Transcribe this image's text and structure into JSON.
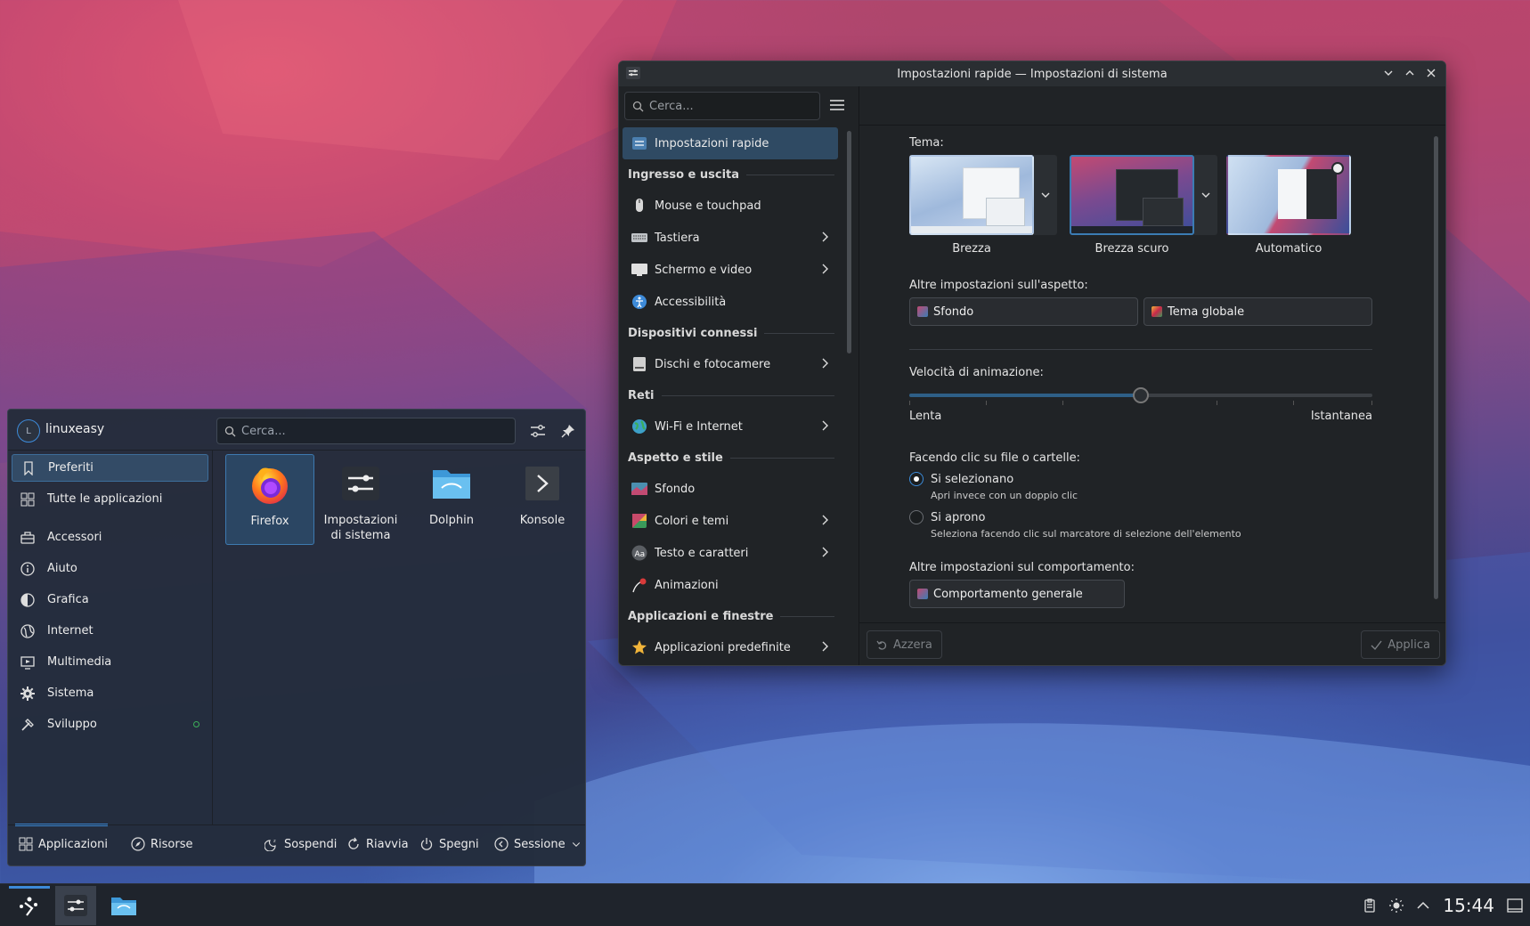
{
  "window": {
    "title": "Impostazioni rapide — Impostazioni di sistema",
    "search_placeholder": "Cerca...",
    "page_title": "Impostazioni rapide"
  },
  "sidebar": {
    "items": [
      {
        "type": "item",
        "label": "Impostazioni rapide",
        "icon": "quick-settings-icon",
        "active": true,
        "chevron": false,
        "color": "#4b7fb0"
      },
      {
        "type": "header",
        "label": "Ingresso e uscita"
      },
      {
        "type": "item",
        "label": "Mouse e touchpad",
        "icon": "mouse-icon",
        "chevron": false,
        "color": "#d8d8d8"
      },
      {
        "type": "item",
        "label": "Tastiera",
        "icon": "keyboard-icon",
        "chevron": true,
        "color": "#bfc3c7"
      },
      {
        "type": "item",
        "label": "Schermo e video",
        "icon": "display-icon",
        "chevron": true,
        "color": "#e0e0e0"
      },
      {
        "type": "item",
        "label": "Accessibilità",
        "icon": "accessibility-icon",
        "chevron": false,
        "color": "#3d8ad8"
      },
      {
        "type": "header",
        "label": "Dispositivi connessi"
      },
      {
        "type": "item",
        "label": "Dischi e fotocamere",
        "icon": "disk-icon",
        "chevron": true,
        "color": "#d0d0d0"
      },
      {
        "type": "header",
        "label": "Reti"
      },
      {
        "type": "item",
        "label": "Wi-Fi e Internet",
        "icon": "globe-icon",
        "chevron": true,
        "color": "#3da0c8"
      },
      {
        "type": "header",
        "label": "Aspetto e stile"
      },
      {
        "type": "item",
        "label": "Sfondo",
        "icon": "wallpaper-icon",
        "chevron": false,
        "color": "#4b8fb0"
      },
      {
        "type": "item",
        "label": "Colori e temi",
        "icon": "palette-icon",
        "chevron": true,
        "color": "#c84a6a"
      },
      {
        "type": "item",
        "label": "Testo e caratteri",
        "icon": "font-icon",
        "chevron": true,
        "color": "#5a5e63"
      },
      {
        "type": "item",
        "label": "Animazioni",
        "icon": "animation-icon",
        "chevron": false,
        "color": "#d83a3a"
      },
      {
        "type": "header",
        "label": "Applicazioni e finestre"
      },
      {
        "type": "item",
        "label": "Applicazioni predefinite",
        "icon": "star-icon",
        "chevron": true,
        "color": "#f0b43a"
      }
    ]
  },
  "main": {
    "theme_label": "Tema:",
    "themes": [
      {
        "name": "Brezza",
        "selected": false,
        "dropdown": true
      },
      {
        "name": "Brezza scuro",
        "selected": true,
        "dropdown": true
      },
      {
        "name": "Automatico",
        "selected": false,
        "dropdown": false
      }
    ],
    "appearance_label": "Altre impostazioni sull'aspetto:",
    "wallpaper_button": "Sfondo",
    "global_theme_button": "Tema globale",
    "animation_label": "Velocità di animazione:",
    "animation_value": 0.5,
    "slow_label": "Lenta",
    "instant_label": "Istantanea",
    "click_label": "Facendo clic su file o cartelle:",
    "radio_select": "Si selezionano",
    "radio_select_sub": "Apri invece con un doppio clic",
    "radio_open": "Si aprono",
    "radio_open_sub": "Seleziona facendo clic sul marcatore di selezione dell'elemento",
    "behavior_label": "Altre impostazioni sul comportamento:",
    "general_behavior_button": "Comportamento generale",
    "reset_button": "Azzera",
    "apply_button": "Applica"
  },
  "launcher": {
    "username": "linuxeasy",
    "avatar_letter": "L",
    "search_placeholder": "Cerca...",
    "categories": [
      {
        "label": "Preferiti",
        "icon": "bookmark-icon",
        "active": true
      },
      {
        "label": "Tutte le applicazioni",
        "icon": "grid-icon",
        "active": false
      },
      {
        "label": "Accessori",
        "icon": "accessories-icon",
        "active": false
      },
      {
        "label": "Aiuto",
        "icon": "help-icon",
        "active": false
      },
      {
        "label": "Grafica",
        "icon": "graphics-icon",
        "active": false
      },
      {
        "label": "Internet",
        "icon": "globe-icon",
        "active": false
      },
      {
        "label": "Multimedia",
        "icon": "multimedia-icon",
        "active": false
      },
      {
        "label": "Sistema",
        "icon": "gear-icon",
        "active": false
      },
      {
        "label": "Sviluppo",
        "icon": "hammer-icon",
        "active": false,
        "badge": true
      }
    ],
    "apps": [
      {
        "label": "Firefox",
        "icon": "firefox-icon",
        "selected": true
      },
      {
        "label": "Impostazioni di sistema",
        "icon": "system-settings-icon",
        "selected": false
      },
      {
        "label": "Dolphin",
        "icon": "folder-icon",
        "selected": false
      },
      {
        "label": "Konsole",
        "icon": "terminal-icon",
        "selected": false
      }
    ],
    "bottom": {
      "applications": "Applicazioni",
      "places": "Risorse",
      "suspend": "Sospendi",
      "restart": "Riavvia",
      "shutdown": "Spegni",
      "session": "Sessione"
    }
  },
  "taskbar": {
    "clock": "15:44"
  },
  "colors": {
    "accent": "#3d8ad8",
    "window_bg": "#202326",
    "launcher_bg": "#232c3a"
  }
}
